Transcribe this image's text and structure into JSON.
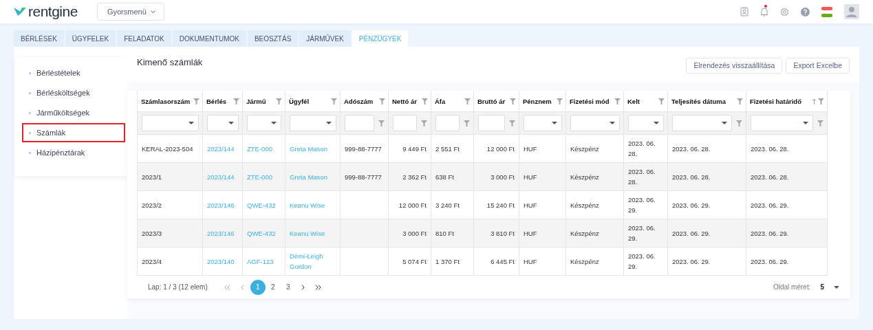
{
  "header": {
    "logo": "rentgine",
    "quick_menu": "Gyorsmenü",
    "icons": [
      {
        "kind": "contacts",
        "badge": false
      },
      {
        "kind": "bell",
        "badge": true
      },
      {
        "kind": "settings",
        "badge": false
      },
      {
        "kind": "help",
        "badge": false
      },
      {
        "kind": "flag",
        "badge": false
      },
      {
        "kind": "avatar",
        "badge": false
      }
    ]
  },
  "tabs": [
    {
      "label": "BÉRLÉSEK",
      "selected": false
    },
    {
      "label": "ÜGYFELEK",
      "selected": false
    },
    {
      "label": "FELADATOK",
      "selected": false
    },
    {
      "label": "DOKUMENTUMOK",
      "selected": false
    },
    {
      "label": "BEOSZTÁS",
      "selected": false
    },
    {
      "label": "JÁRMŰVEK",
      "selected": false
    },
    {
      "label": "PÉNZÜGYEK",
      "selected": true
    }
  ],
  "sidebar": {
    "items": [
      {
        "label": "Bérléstételek",
        "selected": false
      },
      {
        "label": "Bérlésköltségek",
        "selected": false
      },
      {
        "label": "Járműköltségek",
        "selected": false
      },
      {
        "label": "Számlák",
        "selected": true
      },
      {
        "label": "Házipénztárak",
        "selected": false
      }
    ]
  },
  "page": {
    "title": "Kimenő számlák",
    "buttons": [
      "Elrendezés visszaállítása",
      "Export Excelbe"
    ]
  },
  "table": {
    "columns": [
      {
        "label": "Számlasorszám",
        "kind": "select",
        "link": false,
        "numeric": false,
        "sorted": false
      },
      {
        "label": "Bérlés",
        "kind": "select",
        "link": true,
        "numeric": false,
        "sorted": false
      },
      {
        "label": "Jármű",
        "kind": "select",
        "link": true,
        "numeric": false,
        "sorted": false
      },
      {
        "label": "Ügyfél",
        "kind": "select",
        "link": true,
        "numeric": false,
        "sorted": false
      },
      {
        "label": "Adószám",
        "kind": "text",
        "link": false,
        "numeric": false,
        "sorted": false
      },
      {
        "label": "Nettó ár",
        "kind": "text",
        "link": false,
        "numeric": true,
        "sorted": false
      },
      {
        "label": "Áfa",
        "kind": "text",
        "link": false,
        "numeric": false,
        "sorted": false
      },
      {
        "label": "Bruttó ár",
        "kind": "text",
        "link": false,
        "numeric": true,
        "sorted": false
      },
      {
        "label": "Pénznem",
        "kind": "select",
        "link": false,
        "numeric": false,
        "sorted": false
      },
      {
        "label": "Fizetési mód",
        "kind": "select",
        "link": false,
        "numeric": false,
        "sorted": false
      },
      {
        "label": "Kelt",
        "kind": "select",
        "link": false,
        "numeric": false,
        "sorted": false
      },
      {
        "label": "Teljesítés dátuma",
        "kind": "selectfilter",
        "link": false,
        "numeric": false,
        "sorted": false
      },
      {
        "label": "Fizetési határidő",
        "kind": "selectfilter",
        "link": false,
        "numeric": false,
        "sorted": true
      }
    ],
    "rows": [
      [
        "KERAL-2023-504",
        "2023/144",
        "ZTE-000",
        "Greta Mason",
        "999-88-7777",
        "9 449 Ft",
        "2 551 Ft",
        "12 000 Ft",
        "HUF",
        "Készpénz",
        "2023. 06. 28.",
        "2023. 06. 28.",
        "2023. 06. 28."
      ],
      [
        "2023/1",
        "2023/144",
        "ZTE-000",
        "Greta Mason",
        "999-88-7777",
        "2 362 Ft",
        "638 Ft",
        "3 000 Ft",
        "HUF",
        "Készpénz",
        "2023. 06. 28.",
        "2023. 06. 28.",
        "2023. 06. 28."
      ],
      [
        "2023/2",
        "2023/146",
        "QWE-432",
        "Keanu Wise",
        "",
        "12 000 Ft",
        "3 240 Ft",
        "15 240 Ft",
        "HUF",
        "Készpénz",
        "2023. 06. 29.",
        "2023. 06. 29.",
        "2023. 06. 29."
      ],
      [
        "2023/3",
        "2023/146",
        "QWE-432",
        "Keanu Wise",
        "",
        "3 000 Ft",
        "810 Ft",
        "3 810 Ft",
        "HUF",
        "Készpénz",
        "2023. 06. 29.",
        "2023. 06. 29.",
        "2023. 06. 29."
      ],
      [
        "2023/4",
        "2023/140",
        "AGF-123",
        "Demi-Leigh Gordon",
        "",
        "5 074 Ft",
        "1 370 Ft",
        "6 445 Ft",
        "HUF",
        "Készpénz",
        "2023. 06. 29.",
        "2023. 06. 29.",
        "2023. 06. 29."
      ]
    ]
  },
  "pagination": {
    "info": "Lap: 1 / 3 (12 elem)",
    "pages": [
      {
        "label": "1",
        "selected": true
      },
      {
        "label": "2",
        "selected": false
      },
      {
        "label": "3",
        "selected": false
      }
    ],
    "page_size_label": "Oldal méret:",
    "page_size": "5"
  }
}
